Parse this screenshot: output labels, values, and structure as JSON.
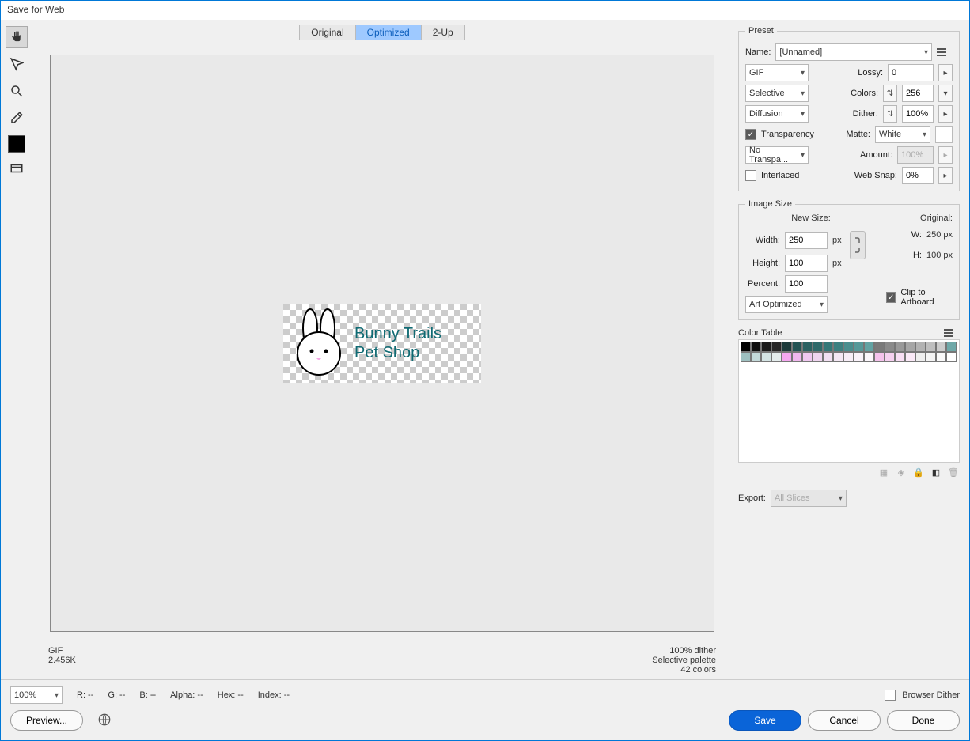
{
  "window_title": "Save for Web",
  "tabs": {
    "original": "Original",
    "optimized": "Optimized",
    "twoup": "2-Up"
  },
  "canvas": {
    "artboard_text_line1": "Bunny Trails",
    "artboard_text_line2": "Pet Shop"
  },
  "canvas_footer": {
    "format": "GIF",
    "size": "2.456K",
    "dither": "100% dither",
    "palette": "Selective palette",
    "colors": "42 colors"
  },
  "preset": {
    "legend": "Preset",
    "name_label": "Name:",
    "name_value": "[Unnamed]",
    "format": "GIF",
    "lossy_label": "Lossy:",
    "lossy_value": "0",
    "reduction": "Selective",
    "colors_label": "Colors:",
    "colors_value": "256",
    "dither_method": "Diffusion",
    "dither_label": "Dither:",
    "dither_value": "100%",
    "transparency_label": "Transparency",
    "matte_label": "Matte:",
    "matte_value": "White",
    "transp_dither": "No Transpa...",
    "amount_label": "Amount:",
    "amount_value": "100%",
    "interlaced_label": "Interlaced",
    "websnap_label": "Web Snap:",
    "websnap_value": "0%"
  },
  "image_size": {
    "legend": "Image Size",
    "new_size": "New Size:",
    "width_label": "Width:",
    "width_value": "250",
    "height_label": "Height:",
    "height_value": "100",
    "px": "px",
    "percent_label": "Percent:",
    "percent_value": "100",
    "quality": "Art Optimized",
    "original_label": "Original:",
    "orig_w_label": "W:",
    "orig_w_value": "250 px",
    "orig_h_label": "H:",
    "orig_h_value": "100 px",
    "clip_label": "Clip to Artboard"
  },
  "color_table": {
    "title": "Color Table",
    "colors": [
      "#000000",
      "#0d0d0d",
      "#1a1a1a",
      "#262626",
      "#1c3a3a",
      "#245454",
      "#2c6262",
      "#2f6a6a",
      "#357878",
      "#3d8080",
      "#4a8e8e",
      "#569999",
      "#63a3a3",
      "#7a7a7a",
      "#8a8a8a",
      "#999999",
      "#a6a6a6",
      "#b3b3b3",
      "#bfbfbf",
      "#cccccc",
      "#6fa8a8",
      "#9ec0c0",
      "#c3d9d9",
      "#d4e4e4",
      "#e5eded",
      "#f5a8f0",
      "#f1b8ee",
      "#f0c8f0",
      "#efd5ef",
      "#f2e0f2",
      "#f4e8f4",
      "#f7eef7",
      "#faf3fa",
      "#fbf7fb",
      "#f5c2ec",
      "#f6d0f0",
      "#f8def4",
      "#fae9f7",
      "#eeeeee",
      "#f4f4f4",
      "#fafafa",
      "#ffffff"
    ]
  },
  "export_label": "Export:",
  "export_value": "All Slices",
  "bottom": {
    "zoom": "100%",
    "r": "R: --",
    "g": "G: --",
    "b": "B: --",
    "alpha": "Alpha: --",
    "hex": "Hex: --",
    "index": "Index: --",
    "browser_dither": "Browser Dither",
    "preview_btn": "Preview...",
    "save": "Save",
    "cancel": "Cancel",
    "done": "Done"
  }
}
